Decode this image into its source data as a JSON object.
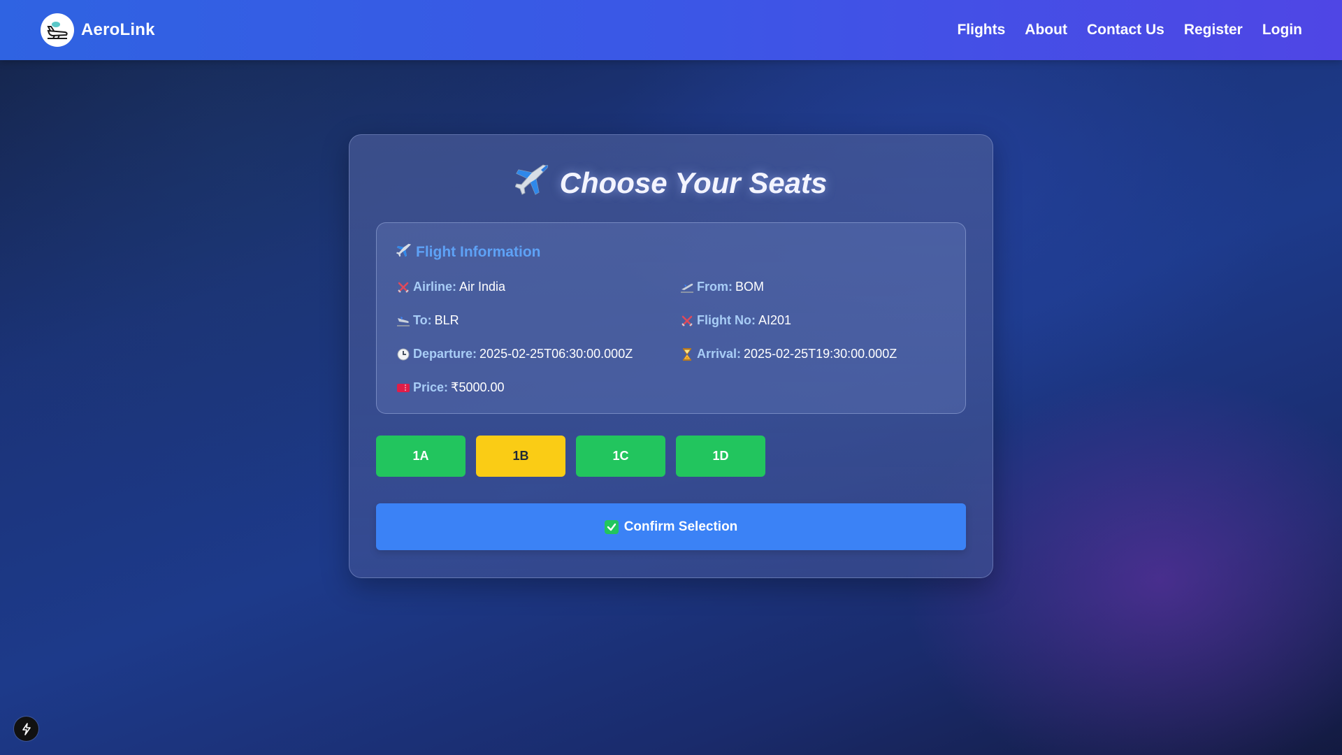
{
  "navbar": {
    "brand": "AeroLink",
    "links": [
      "Flights",
      "About",
      "Contact Us",
      "Register",
      "Login"
    ]
  },
  "page": {
    "title": "Choose Your Seats"
  },
  "flight_info": {
    "heading": "Flight Information",
    "airline": {
      "label": "Airline:",
      "value": "Air India"
    },
    "from": {
      "label": "From:",
      "value": "BOM"
    },
    "to": {
      "label": "To:",
      "value": "BLR"
    },
    "flight_no": {
      "label": "Flight No:",
      "value": "AI201"
    },
    "departure": {
      "label": "Departure:",
      "value": "2025-02-25T06:30:00.000Z"
    },
    "arrival": {
      "label": "Arrival:",
      "value": "2025-02-25T19:30:00.000Z"
    },
    "price": {
      "label": "Price:",
      "value": "₹5000.00"
    }
  },
  "seats": [
    {
      "label": "1A",
      "selected": false
    },
    {
      "label": "1B",
      "selected": true
    },
    {
      "label": "1C",
      "selected": false
    },
    {
      "label": "1D",
      "selected": false
    }
  ],
  "confirm_button": {
    "label": "Confirm Selection"
  },
  "colors": {
    "seat_available": "#22c55e",
    "seat_selected": "#facc15",
    "confirm": "#3b82f6",
    "label": "#a8cdf6",
    "heading": "#5ea2f6"
  },
  "icons": {
    "brand": "airplane-logo-icon",
    "title": "airplane-icon",
    "heading": "airplane-icon",
    "airline": "crossed-swords-icon",
    "from": "departure-icon",
    "to": "arrival-icon",
    "flight_no": "crossed-swords-icon",
    "departure": "clock-icon",
    "arrival": "hourglass-icon",
    "price": "ticket-icon",
    "confirm": "check-box-icon",
    "corner": "lightning-icon"
  }
}
